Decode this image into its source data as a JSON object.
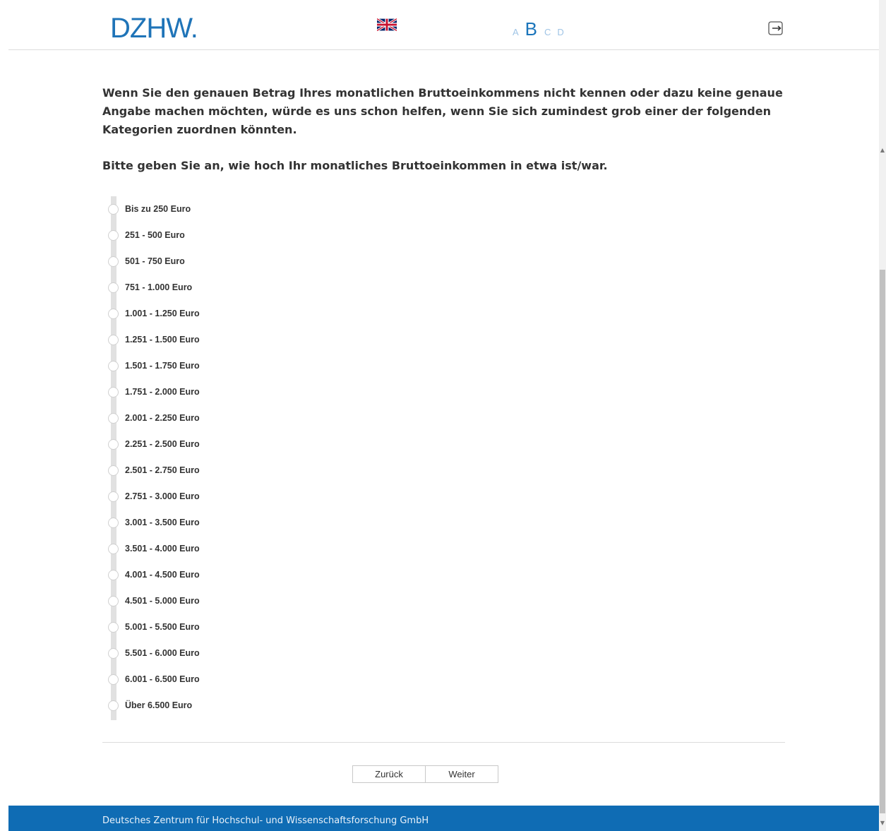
{
  "header": {
    "logo": "DZHW.",
    "language_icon": "uk-flag-icon",
    "font_sizes": [
      "A",
      "B",
      "C",
      "D"
    ],
    "active_font_size": "B",
    "logout_icon": "logout-icon"
  },
  "question": {
    "intro": "Wenn Sie den genauen Betrag Ihres monatlichen Bruttoeinkommens nicht kennen oder dazu keine genaue Angabe machen möchten, würde es uns schon helfen, wenn Sie sich zumindest grob einer der folgenden Kategorien zuordnen könnten.",
    "prompt": "Bitte geben Sie an, wie hoch Ihr monatliches Bruttoeinkommen in etwa ist/war."
  },
  "options": [
    "Bis zu 250 Euro",
    "251 - 500 Euro",
    "501 - 750 Euro",
    "751 - 1.000 Euro",
    "1.001 - 1.250 Euro",
    "1.251 - 1.500 Euro",
    "1.501 - 1.750 Euro",
    "1.751 - 2.000 Euro",
    "2.001 - 2.250 Euro",
    "2.251 - 2.500 Euro",
    "2.501 - 2.750 Euro",
    "2.751 - 3.000 Euro",
    "3.001 - 3.500 Euro",
    "3.501 - 4.000 Euro",
    "4.001 - 4.500 Euro",
    "4.501 - 5.000 Euro",
    "5.001 - 5.500 Euro",
    "5.501 - 6.000 Euro",
    "6.001 - 6.500 Euro",
    "Über 6.500 Euro"
  ],
  "navigation": {
    "back": "Zurück",
    "next": "Weiter"
  },
  "footer": {
    "text": "Deutsches Zentrum für Hochschul- und Wissenschaftsforschung GmbH"
  },
  "colors": {
    "brand": "#1f74b8",
    "footer_bg": "#0f6cb4"
  }
}
